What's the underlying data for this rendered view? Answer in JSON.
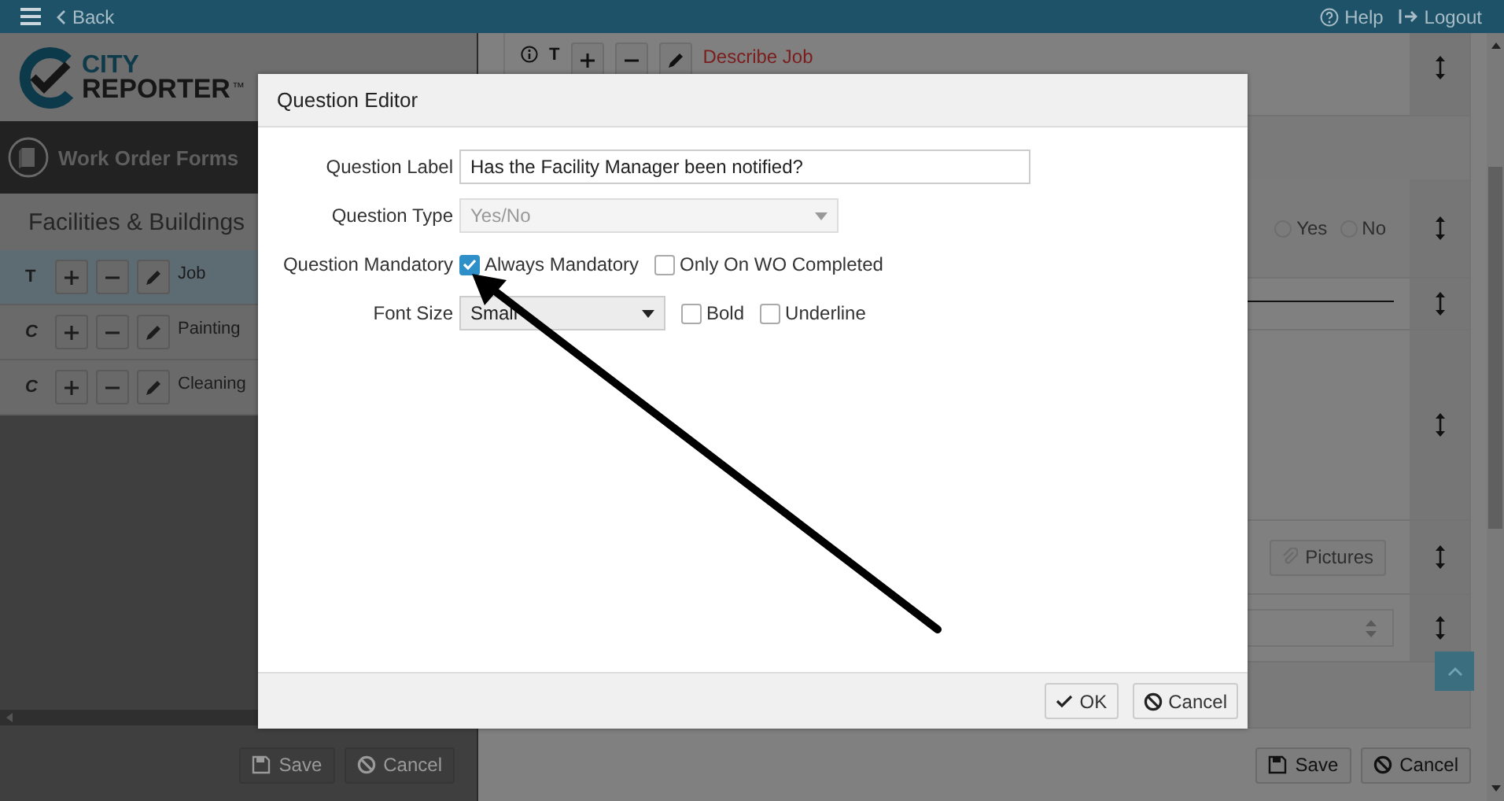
{
  "topbar": {
    "back": "Back",
    "help": "Help",
    "logout": "Logout"
  },
  "logo": {
    "line1": "CITY",
    "line2": "REPORTER",
    "mark": "™"
  },
  "sidebar": {
    "title": "Work Order Forms",
    "heading": "Facilities & Buildings",
    "items": [
      {
        "kind": "text",
        "glyph": "T",
        "label": "Job",
        "selected": true
      },
      {
        "kind": "choice",
        "glyph": "C",
        "label": "Painting",
        "selected": false
      },
      {
        "kind": "choice",
        "glyph": "C",
        "label": "Cleaning",
        "selected": false
      }
    ],
    "buttons": [
      {
        "kind": "save",
        "label": "Save"
      },
      {
        "kind": "cancel",
        "label": "Cancel"
      }
    ]
  },
  "main": {
    "rows": [
      {
        "kind": "question",
        "glyph": "T",
        "label": "Describe Job"
      },
      {
        "kind": "radio",
        "options": [
          {
            "label": "Yes",
            "selected": false
          },
          {
            "label": "No",
            "selected": false
          }
        ]
      },
      {
        "kind": "line"
      },
      {
        "kind": "blank"
      },
      {
        "kind": "pictures",
        "button": "Pictures"
      },
      {
        "kind": "number"
      }
    ],
    "buttons": [
      {
        "kind": "save",
        "label": "Save"
      },
      {
        "kind": "cancel",
        "label": "Cancel"
      }
    ]
  },
  "dialog": {
    "title": "Question Editor",
    "fields": [
      {
        "kind": "text",
        "label": "Question Label",
        "value": "Has the Facility Manager been notified?"
      },
      {
        "kind": "select",
        "label": "Question Type",
        "value": "Yes/No",
        "disabled": true
      },
      {
        "kind": "checks",
        "label": "Question Mandatory",
        "options": [
          {
            "label": "Always Mandatory",
            "checked": true
          },
          {
            "label": "Only On WO Completed",
            "checked": false
          }
        ]
      },
      {
        "kind": "select",
        "label": "Font Size",
        "value": "Small",
        "disabled": false,
        "options": [
          {
            "label": "Bold",
            "checked": false
          },
          {
            "label": "Underline",
            "checked": false
          }
        ]
      }
    ],
    "buttons": [
      {
        "kind": "ok",
        "label": "OK"
      },
      {
        "kind": "cancel",
        "label": "Cancel"
      }
    ]
  }
}
